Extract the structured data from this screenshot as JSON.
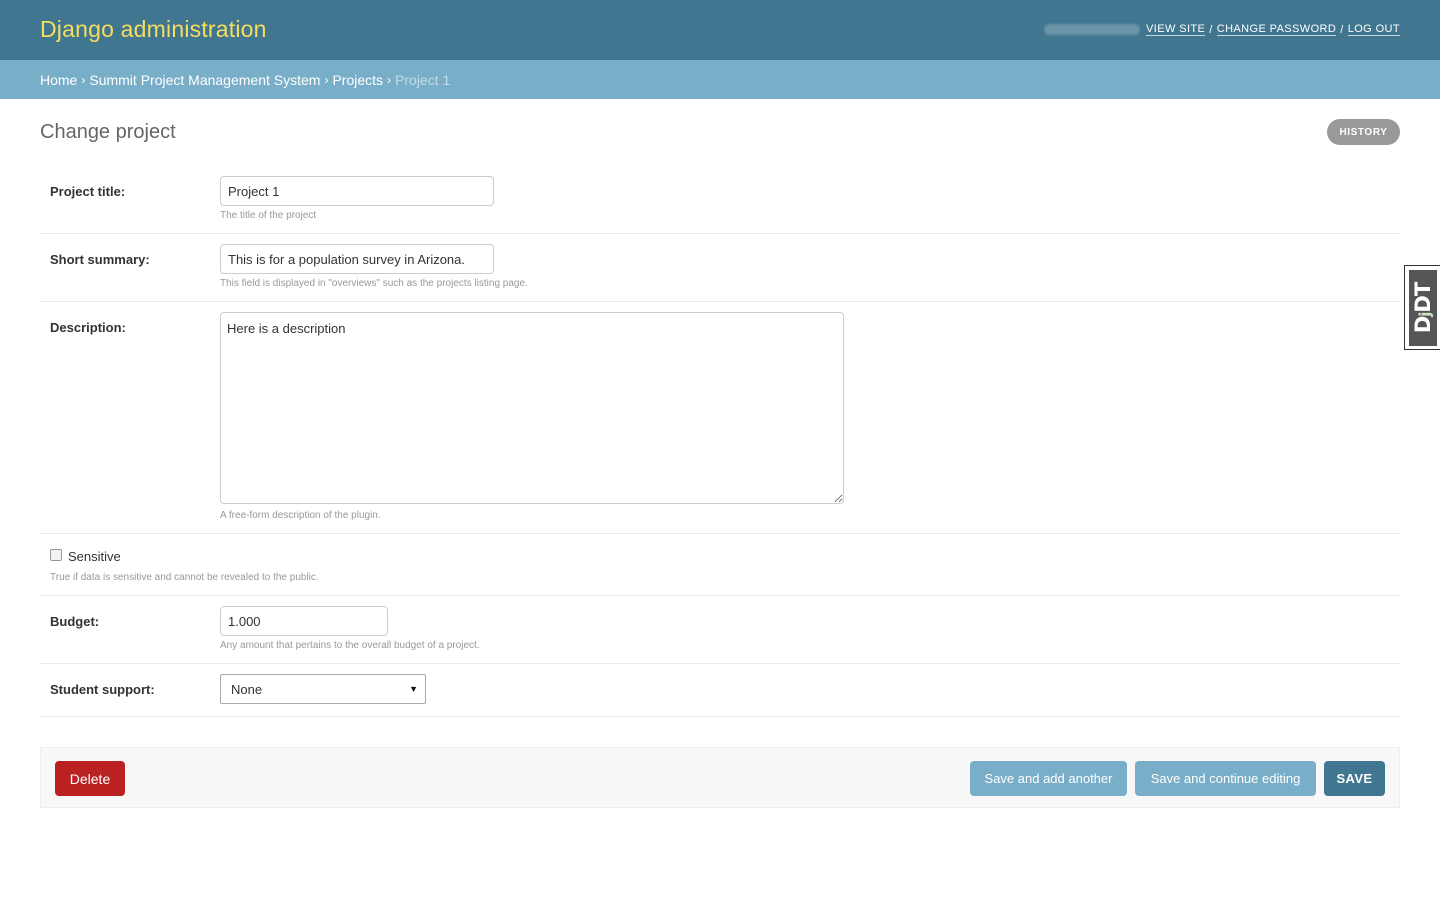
{
  "header": {
    "branding": "Django administration",
    "user_tools": {
      "view_site": "VIEW SITE",
      "change_password": "CHANGE PASSWORD",
      "log_out": "LOG OUT",
      "separator": "/"
    }
  },
  "breadcrumbs": {
    "items": [
      "Home",
      "Summit Project Management System",
      "Projects"
    ],
    "current": "Project 1",
    "separator": "›"
  },
  "page": {
    "title": "Change project",
    "history_label": "HISTORY"
  },
  "form": {
    "project_title": {
      "label": "Project title:",
      "value": "Project 1",
      "help": "The title of the project"
    },
    "short_summary": {
      "label": "Short summary:",
      "value": "This is for a population survey in Arizona.",
      "help": "This field is displayed in \"overviews\" such as the projects listing page."
    },
    "description": {
      "label": "Description:",
      "value": "Here is a description",
      "help": "A free-form description of the plugin."
    },
    "sensitive": {
      "label": "Sensitive",
      "checked": false,
      "help": "True if data is sensitive and cannot be revealed to the public."
    },
    "budget": {
      "label": "Budget:",
      "value": "1.000",
      "help": "Any amount that pertains to the overall budget of a project."
    },
    "student_support": {
      "label": "Student support:",
      "selected": "None"
    }
  },
  "submit_row": {
    "delete": "Delete",
    "save_add_another": "Save and add another",
    "save_continue": "Save and continue editing",
    "save": "SAVE"
  },
  "debug_toolbar": {
    "handle_text": "DjDT"
  },
  "colors": {
    "header_bg": "#417690",
    "branding": "#f5dd5d",
    "breadcrumbs_bg": "#79aec8",
    "delete": "#ba2121",
    "secondary_button": "#79aec8",
    "primary_button": "#417690"
  },
  "icons": {
    "select_arrow": "caret-down-icon"
  }
}
